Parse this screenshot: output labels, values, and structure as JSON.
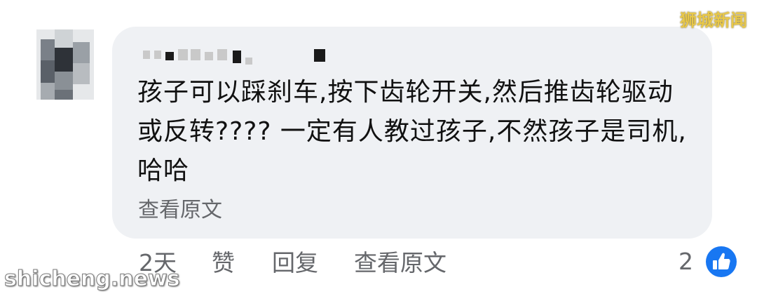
{
  "watermark": {
    "top_right": "狮城新闻",
    "bottom_left": "shicheng.news"
  },
  "comment": {
    "text": "孩子可以踩刹车,按下齿轮开关,然后推齿轮驱动或反转???? 一定有人教过孩子,不然孩子是司机,哈哈",
    "see_original_inline": "查看原文"
  },
  "actions": {
    "time": "2天",
    "like": "赞",
    "reply": "回复",
    "see_original": "查看原文"
  },
  "reactions": {
    "count": "2",
    "icon": "thumbs-up-icon",
    "color": "#1877f2"
  },
  "colors": {
    "bubble": "#eff1f4",
    "secondary_text": "#65676b"
  }
}
